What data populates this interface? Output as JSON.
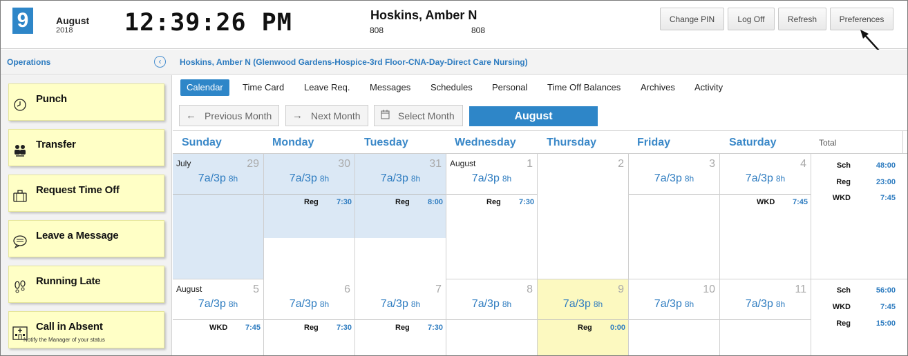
{
  "header": {
    "day": "9",
    "month": "August",
    "year": "2018",
    "clock": "12:39:26 PM",
    "employee_name": "Hoskins, Amber N",
    "code_left": "808",
    "code_right": "808",
    "buttons": {
      "change_pin": "Change PIN",
      "log_off": "Log Off",
      "refresh": "Refresh",
      "preferences": "Preferences"
    }
  },
  "subbar": {
    "operations": "Operations",
    "employee_full": "Hoskins, Amber N (Glenwood Gardens-Hospice-3rd Floor-CNA-Day-Direct Care Nursing)"
  },
  "sidebar": {
    "actions": [
      {
        "label": "Punch",
        "icon": "clock-icon"
      },
      {
        "label": "Transfer",
        "icon": "transfer-icon"
      },
      {
        "label": "Request Time Off",
        "icon": "suitcase-icon"
      },
      {
        "label": "Leave a Message",
        "icon": "chat-bubble-icon"
      },
      {
        "label": "Running Late",
        "icon": "footprints-icon"
      },
      {
        "label": "Call in Absent",
        "icon": "hospital-icon",
        "sub": "Notify the Manager of your status"
      }
    ]
  },
  "tabs": [
    "Calendar",
    "Time Card",
    "Leave Req.",
    "Messages",
    "Schedules",
    "Personal",
    "Time Off Balances",
    "Archives",
    "Activity"
  ],
  "month_nav": {
    "previous": "Previous Month",
    "next": "Next Month",
    "select": "Select Month",
    "current": "August"
  },
  "calendar": {
    "days_of_week": [
      "Sunday",
      "Monday",
      "Tuesday",
      "Wednesday",
      "Thursday",
      "Friday",
      "Saturday"
    ],
    "total_label": "Total",
    "weeks": [
      {
        "cells": [
          {
            "month": "July",
            "day": "29",
            "shift": "7a/3p",
            "hours": "8h",
            "kind": "",
            "value": ""
          },
          {
            "month": "",
            "day": "30",
            "shift": "7a/3p",
            "hours": "8h",
            "kind": "Reg",
            "value": "7:30"
          },
          {
            "month": "",
            "day": "31",
            "shift": "7a/3p",
            "hours": "8h",
            "kind": "Reg",
            "value": "8:00"
          },
          {
            "month": "August",
            "day": "1",
            "shift": "7a/3p",
            "hours": "8h",
            "kind": "Reg",
            "value": "7:30"
          },
          {
            "month": "",
            "day": "2",
            "shift": "",
            "hours": "",
            "kind": "",
            "value": ""
          },
          {
            "month": "",
            "day": "3",
            "shift": "7a/3p",
            "hours": "8h",
            "kind": "",
            "value": ""
          },
          {
            "month": "",
            "day": "4",
            "shift": "7a/3p",
            "hours": "8h",
            "kind": "WKD",
            "value": "7:45"
          }
        ],
        "totals": [
          {
            "k": "Sch",
            "v": "48:00"
          },
          {
            "k": "Reg",
            "v": "23:00"
          },
          {
            "k": "WKD",
            "v": "7:45"
          }
        ]
      },
      {
        "cells": [
          {
            "month": "August",
            "day": "5",
            "shift": "7a/3p",
            "hours": "8h",
            "kind": "WKD",
            "value": "7:45"
          },
          {
            "month": "",
            "day": "6",
            "shift": "7a/3p",
            "hours": "8h",
            "kind": "Reg",
            "value": "7:30"
          },
          {
            "month": "",
            "day": "7",
            "shift": "7a/3p",
            "hours": "8h",
            "kind": "Reg",
            "value": "7:30"
          },
          {
            "month": "",
            "day": "8",
            "shift": "7a/3p",
            "hours": "8h",
            "kind": "",
            "value": ""
          },
          {
            "month": "",
            "day": "9",
            "shift": "7a/3p",
            "hours": "8h",
            "kind": "Reg",
            "value": "0:00"
          },
          {
            "month": "",
            "day": "10",
            "shift": "7a/3p",
            "hours": "8h",
            "kind": "",
            "value": ""
          },
          {
            "month": "",
            "day": "11",
            "shift": "7a/3p",
            "hours": "8h",
            "kind": "",
            "value": ""
          }
        ],
        "totals": [
          {
            "k": "Sch",
            "v": "56:00"
          },
          {
            "k": "WKD",
            "v": "7:45"
          },
          {
            "k": "Reg",
            "v": "15:00"
          }
        ]
      }
    ]
  }
}
